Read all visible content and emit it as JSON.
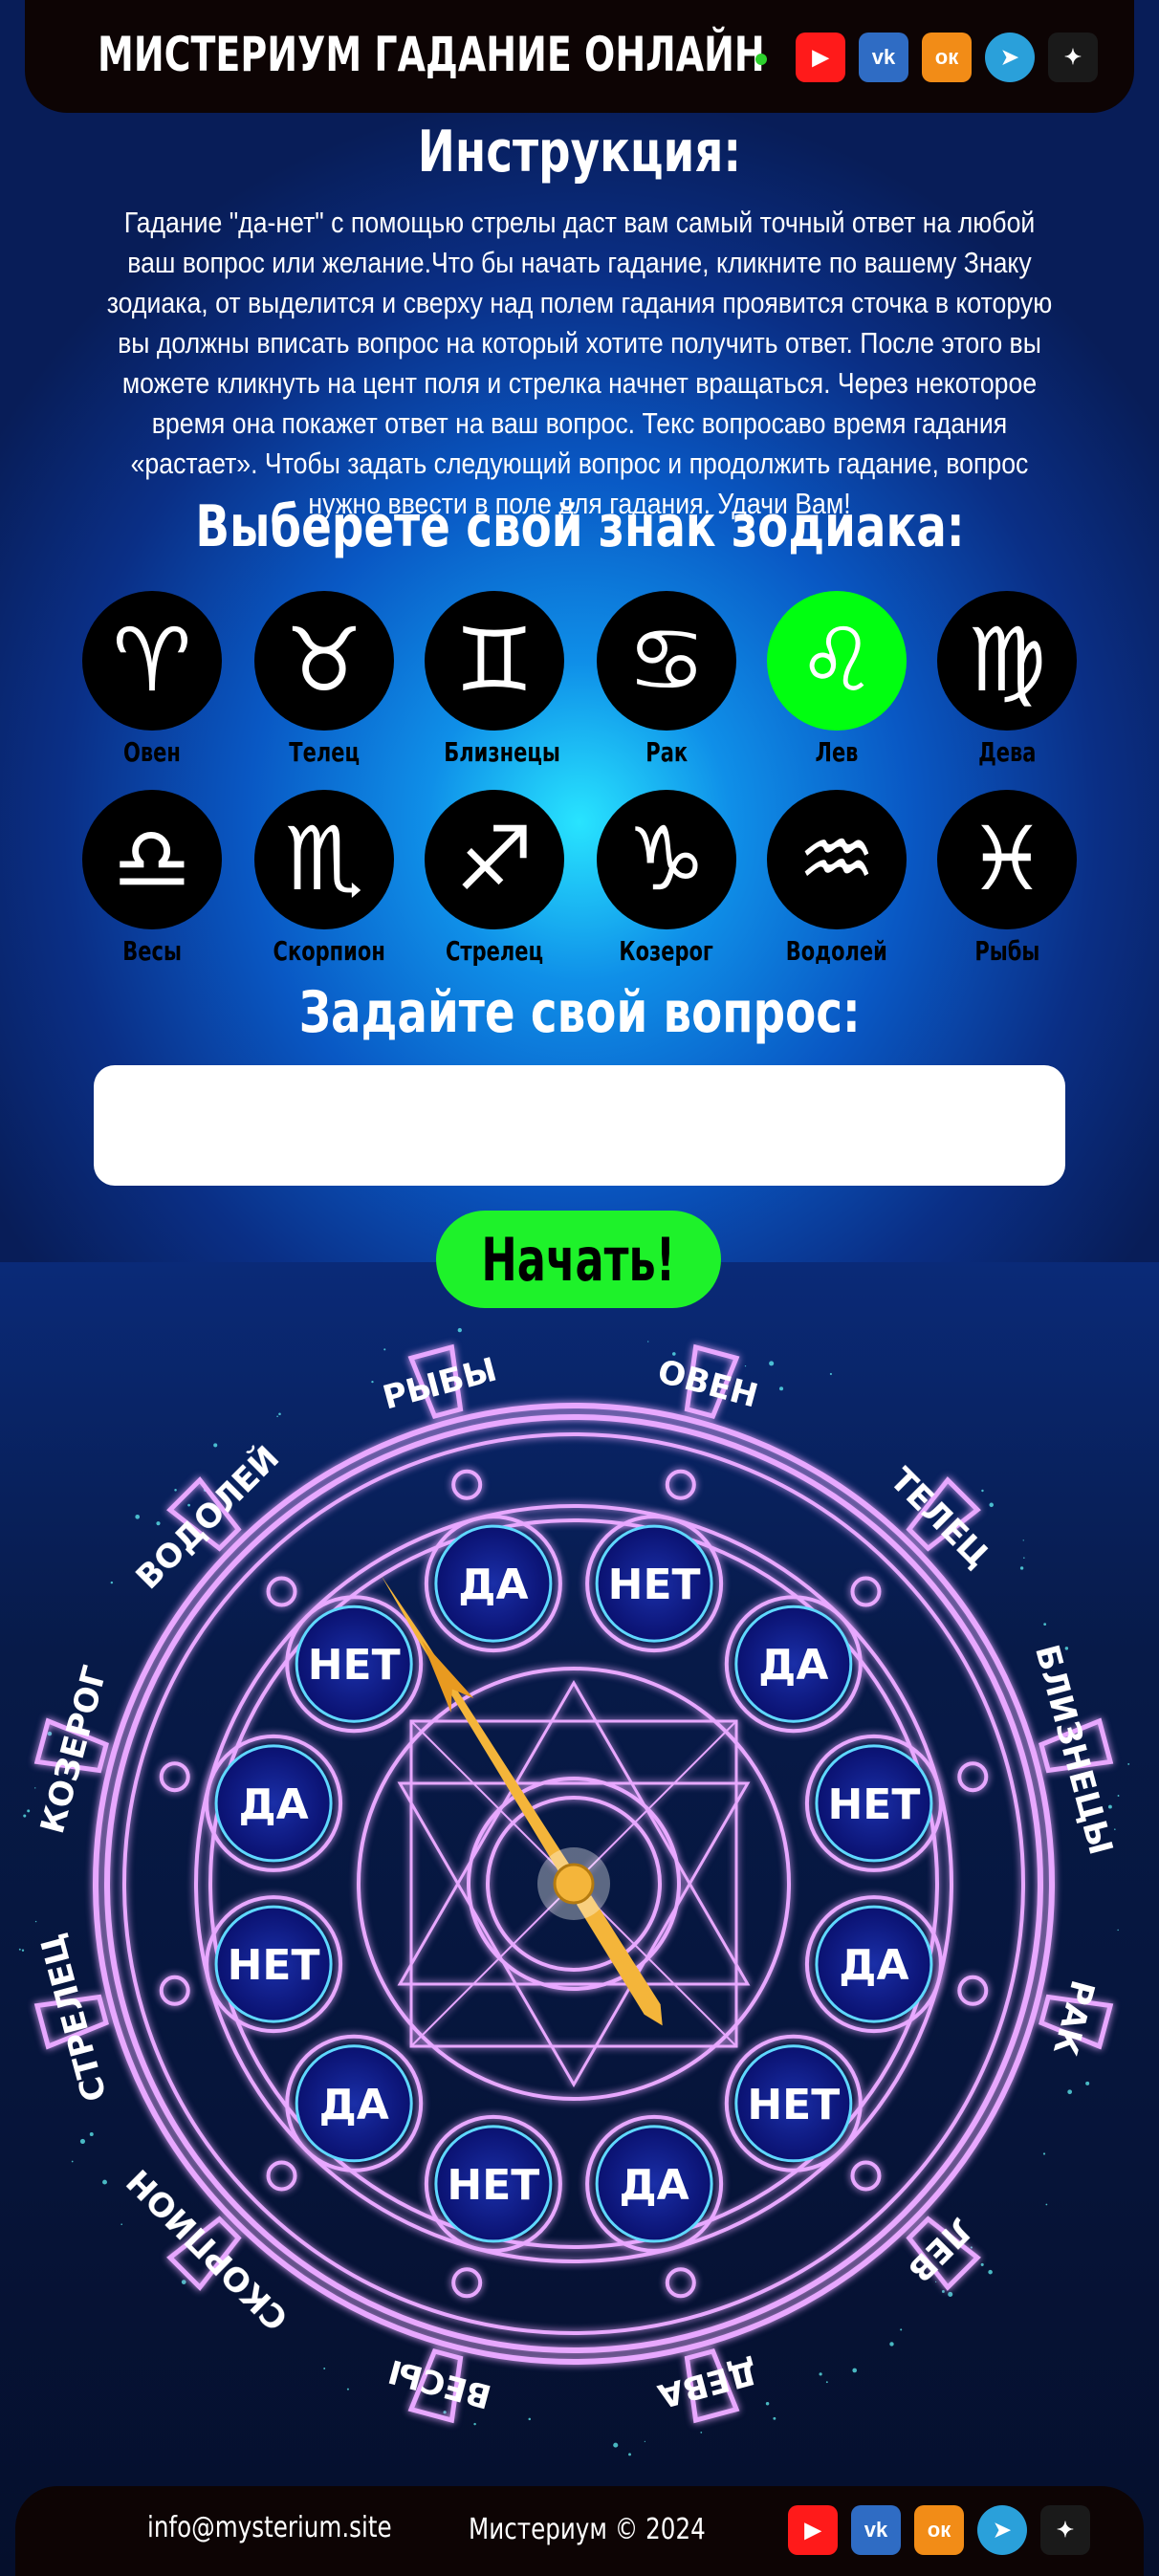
{
  "header": {
    "title": "МИСТЕРИУМ ГАДАНИЕ ОНЛАЙН",
    "socials": [
      {
        "icon": "youtube-icon",
        "glyph": "▶"
      },
      {
        "icon": "vk-icon",
        "glyph": "vk"
      },
      {
        "icon": "odnoklassniki-icon",
        "glyph": "ок"
      },
      {
        "icon": "telegram-icon",
        "glyph": "➤"
      },
      {
        "icon": "star-icon",
        "glyph": "✦"
      }
    ]
  },
  "instructions": {
    "heading": "Инструкция:",
    "text": "Гадание \"да-нет\" с помощью стрелы даст вам самый точный ответ на любой ваш вопрос или желание.Что бы начать гадание, кликните по вашему Знаку зодиака, от выделится и сверху над полем гадания проявится сточка в которую вы должны вписать вопрос на который хотите получить ответ. После этого вы можете кликнуть на цент поля и стрелка начнет вращаться. Через некоторое время она покажет ответ на ваш вопрос. Текс вопросаво время гадания «растает». Чтобы задать следующий вопрос и продолжить гадание, вопрос нужно ввести в поле для гадания. Удачи Вам!"
  },
  "zodiac": {
    "heading": "Выберете свой знак зодиака:",
    "selected": "Лев",
    "signs": [
      {
        "label": "Овен",
        "glyph": "♈"
      },
      {
        "label": "Телец",
        "glyph": "♉"
      },
      {
        "label": "Близнецы",
        "glyph": "♊"
      },
      {
        "label": "Рак",
        "glyph": "♋"
      },
      {
        "label": "Лев",
        "glyph": "♌"
      },
      {
        "label": "Дева",
        "glyph": "♍"
      },
      {
        "label": "Весы",
        "glyph": "♎"
      },
      {
        "label": "Скорпион",
        "glyph": "♏"
      },
      {
        "label": "Стрелец",
        "glyph": "♐"
      },
      {
        "label": "Козерог",
        "glyph": "♑"
      },
      {
        "label": "Водолей",
        "glyph": "♒"
      },
      {
        "label": "Рыбы",
        "glyph": "♓"
      }
    ]
  },
  "question": {
    "heading": "Задайте свой вопрос:",
    "value": "",
    "placeholder": ""
  },
  "start_button": "Начать!",
  "wheel": {
    "ring_labels": [
      "ОВЕН",
      "ТЕЛЕЦ",
      "БЛИЗНЕЦЫ",
      "РАК",
      "ЛЕВ",
      "ДЕВА",
      "ВЕСЫ",
      "СКОРПИОН",
      "СТРЕЛЕЦ",
      "КОЗЕРОГ",
      "ВОДОЛЕЙ",
      "РЫБЫ"
    ],
    "answers": [
      "НЕТ",
      "ДА",
      "НЕТ",
      "ДА",
      "НЕТ",
      "ДА",
      "НЕТ",
      "ДА",
      "НЕТ",
      "ДА",
      "НЕТ",
      "ДА"
    ],
    "needle_color": "#f4b53a",
    "glow_color": "#e8a8ff"
  },
  "footer": {
    "email": "info@mysterium.site",
    "copyright": "Мистериум © 2024"
  }
}
